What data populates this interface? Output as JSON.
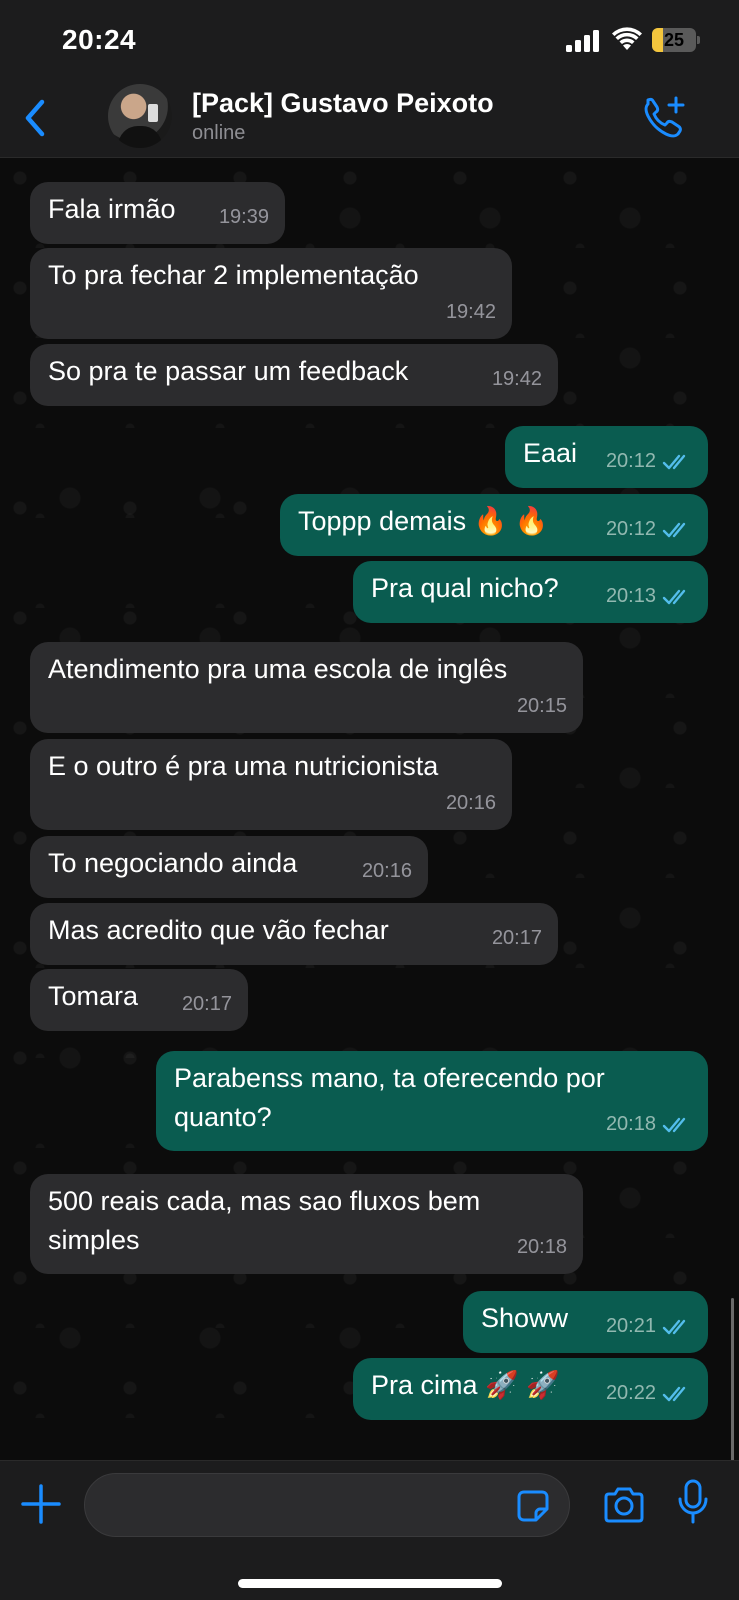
{
  "status_bar": {
    "time": "20:24",
    "battery_level": "25",
    "battery_fraction": 0.25,
    "battery_color": "#f4c63d",
    "icons": [
      "signal-icon",
      "wifi-icon",
      "battery-icon"
    ]
  },
  "header": {
    "contact_name": "[Pack] Gustavo Peixoto",
    "contact_status": "online",
    "accent_color": "#1a8cff",
    "icons": [
      "back-chevron-icon",
      "add-call-icon"
    ]
  },
  "messages": [
    {
      "direction": "in",
      "text": "Fala irmão",
      "time": "19:39"
    },
    {
      "direction": "in",
      "text": "To pra fechar 2 implementação",
      "time": "19:42"
    },
    {
      "direction": "in",
      "text": "So pra te passar um feedback",
      "time": "19:42"
    },
    {
      "direction": "out",
      "text": "Eaai",
      "time": "20:12",
      "status": "read"
    },
    {
      "direction": "out",
      "text": "Toppp demais 🔥 🔥",
      "time": "20:12",
      "status": "read"
    },
    {
      "direction": "out",
      "text": "Pra qual nicho?",
      "time": "20:13",
      "status": "read"
    },
    {
      "direction": "in",
      "text": "Atendimento pra uma escola de inglês",
      "time": "20:15"
    },
    {
      "direction": "in",
      "text": "E o outro é pra uma nutricionista",
      "time": "20:16"
    },
    {
      "direction": "in",
      "text": "To negociando ainda",
      "time": "20:16"
    },
    {
      "direction": "in",
      "text": "Mas acredito que vão fechar",
      "time": "20:17"
    },
    {
      "direction": "in",
      "text": "Tomara",
      "time": "20:17"
    },
    {
      "direction": "out",
      "text": "Parabenss mano, ta oferecendo por\nquanto?",
      "time": "20:18",
      "status": "read"
    },
    {
      "direction": "in",
      "text": "500 reais cada, mas sao fluxos bem\nsimples",
      "time": "20:18"
    },
    {
      "direction": "out",
      "text": "Showw",
      "time": "20:21",
      "status": "read"
    },
    {
      "direction": "out",
      "text": "Pra cima 🚀 🚀",
      "time": "20:22",
      "status": "read"
    }
  ],
  "colors": {
    "incoming_bubble": "#2c2c2e",
    "outgoing_bubble": "#0a5c50",
    "read_ticks": "#53bdeb"
  },
  "input_bar": {
    "message_value": "",
    "icons": [
      "plus-icon",
      "sticker-icon",
      "camera-icon",
      "microphone-icon"
    ]
  }
}
